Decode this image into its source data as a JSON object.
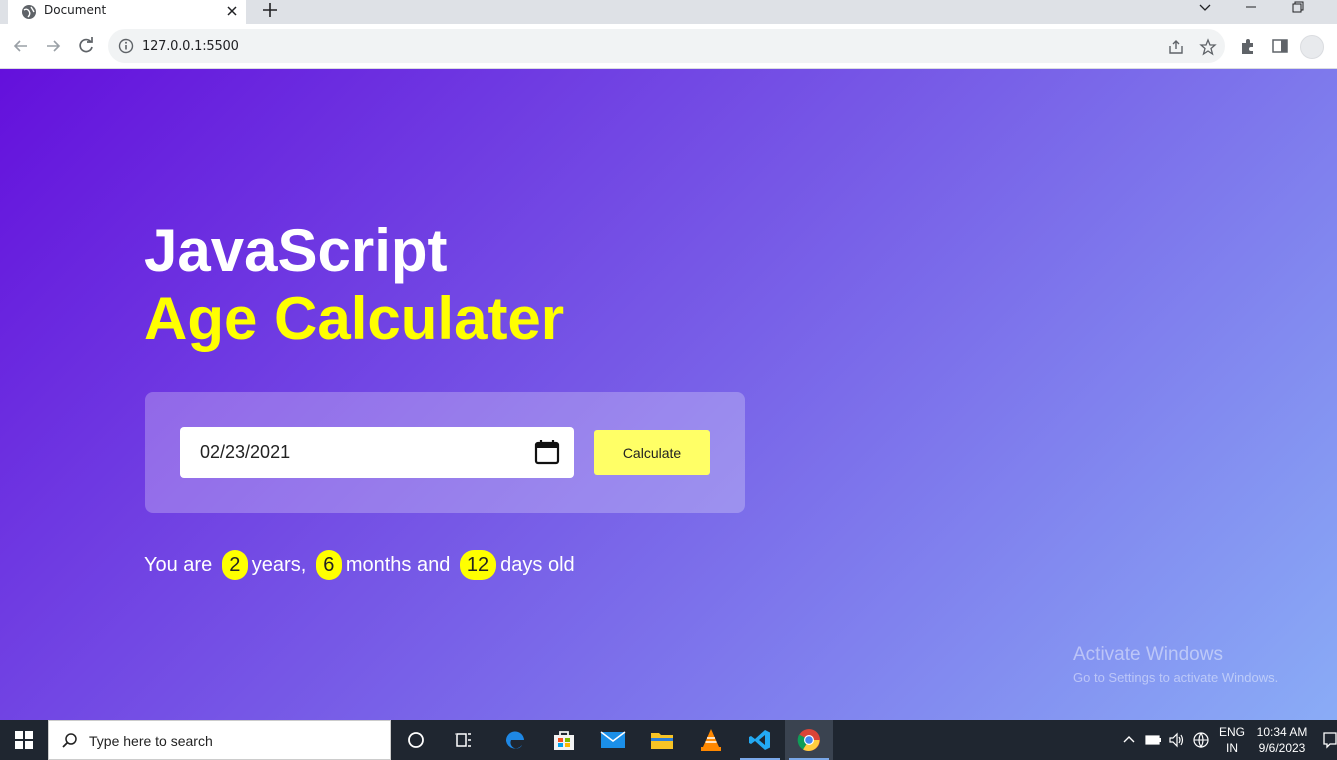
{
  "browser": {
    "tab_title": "Document",
    "url": "127.0.0.1:5500"
  },
  "page": {
    "heading_line1": "JavaScript",
    "heading_line2": "Age Calculater",
    "date_value": "02/23/2021",
    "calculate_label": "Calculate",
    "result": {
      "prefix": "You are",
      "years": "2",
      "years_word": "years,",
      "months": "6",
      "months_word": "months and",
      "days": "12",
      "days_word": "days old"
    },
    "watermark_title": "Activate Windows",
    "watermark_sub": "Go to Settings to activate Windows."
  },
  "colors": {
    "gradient_start": "#6410dc",
    "gradient_end": "#8aacf6",
    "accent_yellow": "#ffff00",
    "button_yellow": "#ffff66"
  },
  "taskbar": {
    "search_placeholder": "Type here to search",
    "lang_line1": "ENG",
    "lang_line2": "IN",
    "time": "10:34 AM",
    "date": "9/6/2023",
    "apps": [
      "cortana-icon",
      "task-view-icon",
      "edge-icon",
      "store-icon",
      "mail-icon",
      "file-explorer-icon",
      "vlc-icon",
      "vscode-icon",
      "chrome-icon"
    ]
  }
}
